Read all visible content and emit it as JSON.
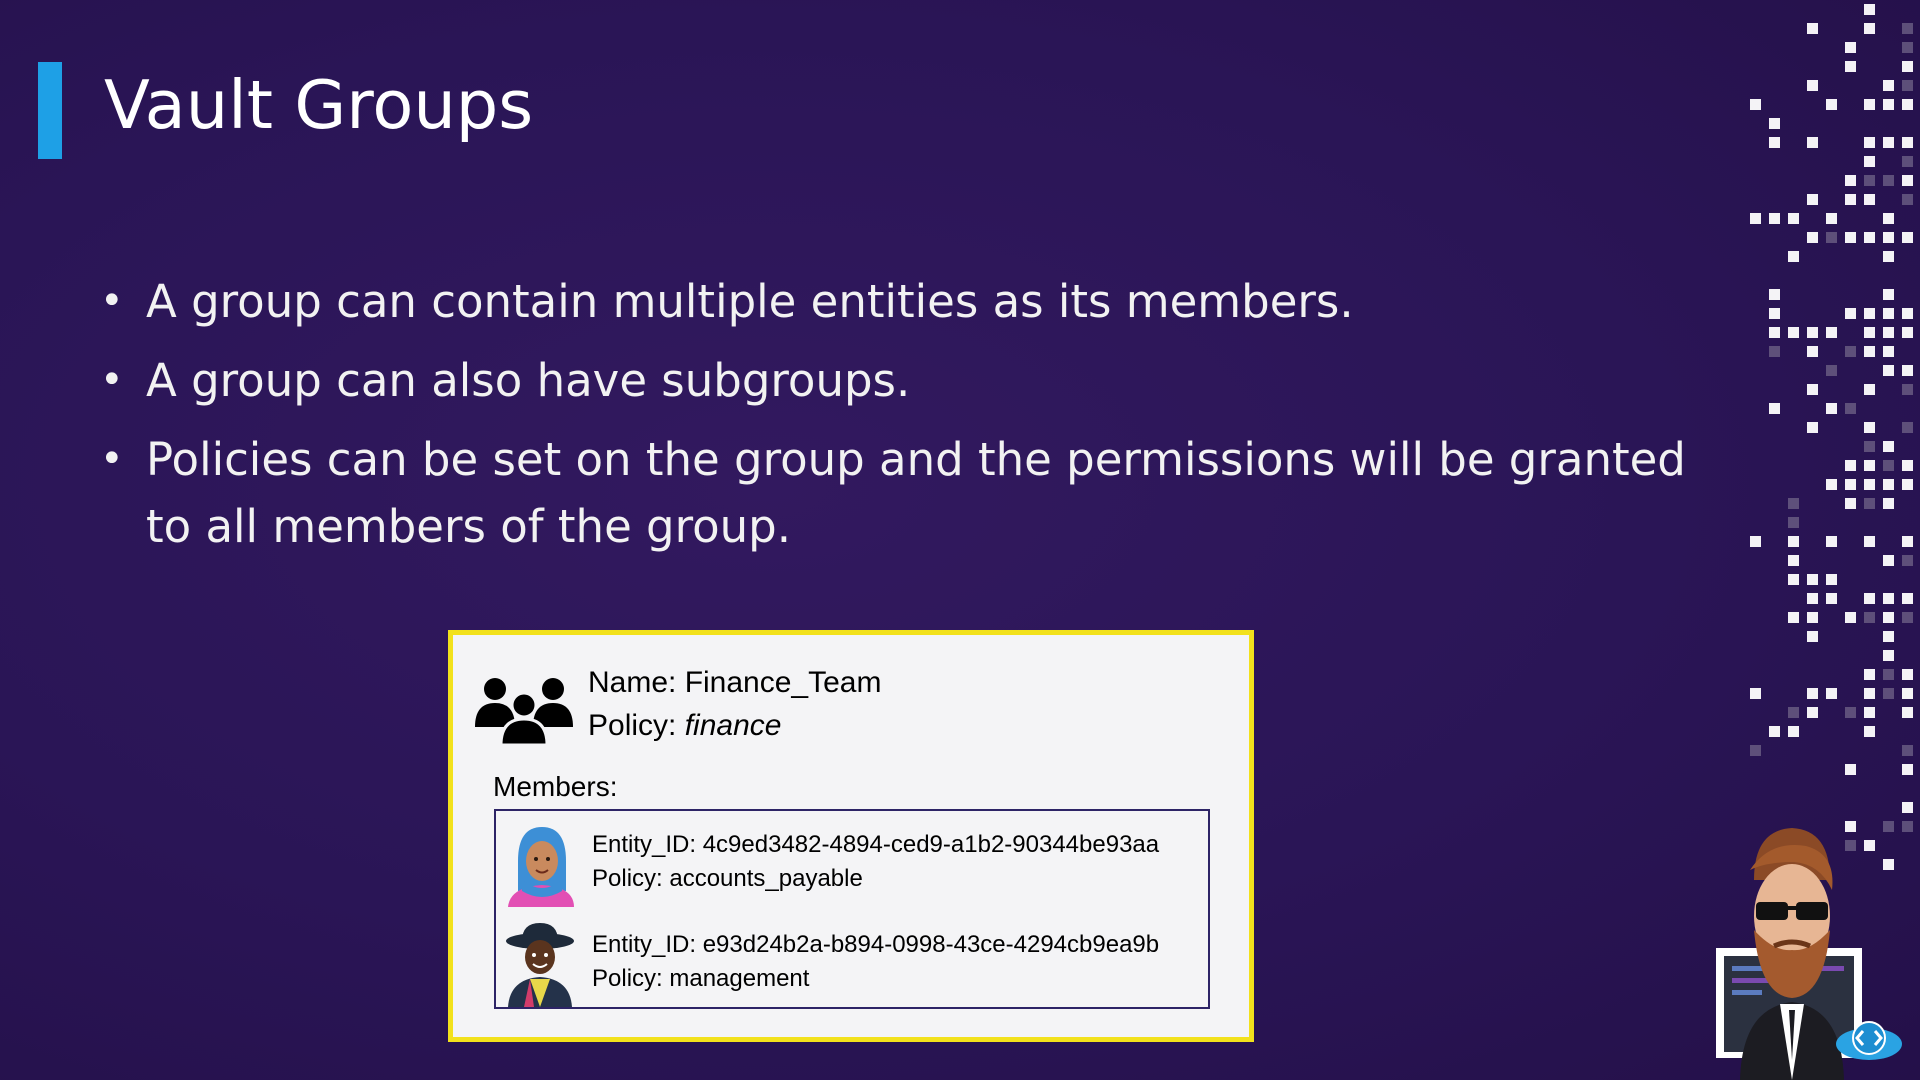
{
  "slide": {
    "title": "Vault Groups",
    "bullets": [
      "A group can contain multiple entities as its members.",
      "A group can also have subgroups.",
      "Policies can be set on the group and the permissions will be granted to all members of the group."
    ]
  },
  "group_card": {
    "name_line": "Name: Finance_Team",
    "policy_prefix": "Policy: ",
    "policy_value": "finance",
    "members_label": "Members:",
    "members": [
      {
        "entity_line": "Entity_ID: 4c9ed3482-4894-ced9-a1b2-90344be93aa",
        "policy_line": "Policy: accounts_payable"
      },
      {
        "entity_line": "Entity_ID: e93d24b2a-b894-0998-43ce-4294cb9ea9b",
        "policy_line": "Policy: management"
      }
    ]
  },
  "colors": {
    "background": "#2b1657",
    "title_accent": "#1ea0e6",
    "card_border": "#f2e11c",
    "members_border": "#2d2466"
  },
  "icons": {
    "group": "users-group-icon",
    "member_1": "woman-hijab-avatar-icon",
    "member_2": "man-hat-avatar-icon",
    "presenter": "presenter-avatar-icon",
    "logo": "code-cloud-logo-icon"
  }
}
